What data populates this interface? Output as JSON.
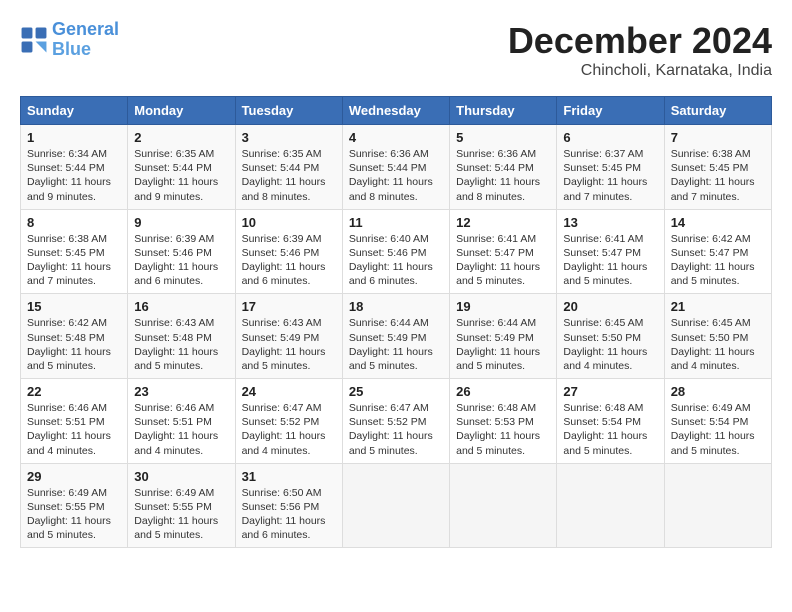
{
  "header": {
    "logo_line1": "General",
    "logo_line2": "Blue",
    "month": "December 2024",
    "location": "Chincholi, Karnataka, India"
  },
  "weekdays": [
    "Sunday",
    "Monday",
    "Tuesday",
    "Wednesday",
    "Thursday",
    "Friday",
    "Saturday"
  ],
  "weeks": [
    [
      {
        "day": "1",
        "info": "Sunrise: 6:34 AM\nSunset: 5:44 PM\nDaylight: 11 hours\nand 9 minutes."
      },
      {
        "day": "2",
        "info": "Sunrise: 6:35 AM\nSunset: 5:44 PM\nDaylight: 11 hours\nand 9 minutes."
      },
      {
        "day": "3",
        "info": "Sunrise: 6:35 AM\nSunset: 5:44 PM\nDaylight: 11 hours\nand 8 minutes."
      },
      {
        "day": "4",
        "info": "Sunrise: 6:36 AM\nSunset: 5:44 PM\nDaylight: 11 hours\nand 8 minutes."
      },
      {
        "day": "5",
        "info": "Sunrise: 6:36 AM\nSunset: 5:44 PM\nDaylight: 11 hours\nand 8 minutes."
      },
      {
        "day": "6",
        "info": "Sunrise: 6:37 AM\nSunset: 5:45 PM\nDaylight: 11 hours\nand 7 minutes."
      },
      {
        "day": "7",
        "info": "Sunrise: 6:38 AM\nSunset: 5:45 PM\nDaylight: 11 hours\nand 7 minutes."
      }
    ],
    [
      {
        "day": "8",
        "info": "Sunrise: 6:38 AM\nSunset: 5:45 PM\nDaylight: 11 hours\nand 7 minutes."
      },
      {
        "day": "9",
        "info": "Sunrise: 6:39 AM\nSunset: 5:46 PM\nDaylight: 11 hours\nand 6 minutes."
      },
      {
        "day": "10",
        "info": "Sunrise: 6:39 AM\nSunset: 5:46 PM\nDaylight: 11 hours\nand 6 minutes."
      },
      {
        "day": "11",
        "info": "Sunrise: 6:40 AM\nSunset: 5:46 PM\nDaylight: 11 hours\nand 6 minutes."
      },
      {
        "day": "12",
        "info": "Sunrise: 6:41 AM\nSunset: 5:47 PM\nDaylight: 11 hours\nand 5 minutes."
      },
      {
        "day": "13",
        "info": "Sunrise: 6:41 AM\nSunset: 5:47 PM\nDaylight: 11 hours\nand 5 minutes."
      },
      {
        "day": "14",
        "info": "Sunrise: 6:42 AM\nSunset: 5:47 PM\nDaylight: 11 hours\nand 5 minutes."
      }
    ],
    [
      {
        "day": "15",
        "info": "Sunrise: 6:42 AM\nSunset: 5:48 PM\nDaylight: 11 hours\nand 5 minutes."
      },
      {
        "day": "16",
        "info": "Sunrise: 6:43 AM\nSunset: 5:48 PM\nDaylight: 11 hours\nand 5 minutes."
      },
      {
        "day": "17",
        "info": "Sunrise: 6:43 AM\nSunset: 5:49 PM\nDaylight: 11 hours\nand 5 minutes."
      },
      {
        "day": "18",
        "info": "Sunrise: 6:44 AM\nSunset: 5:49 PM\nDaylight: 11 hours\nand 5 minutes."
      },
      {
        "day": "19",
        "info": "Sunrise: 6:44 AM\nSunset: 5:49 PM\nDaylight: 11 hours\nand 5 minutes."
      },
      {
        "day": "20",
        "info": "Sunrise: 6:45 AM\nSunset: 5:50 PM\nDaylight: 11 hours\nand 4 minutes."
      },
      {
        "day": "21",
        "info": "Sunrise: 6:45 AM\nSunset: 5:50 PM\nDaylight: 11 hours\nand 4 minutes."
      }
    ],
    [
      {
        "day": "22",
        "info": "Sunrise: 6:46 AM\nSunset: 5:51 PM\nDaylight: 11 hours\nand 4 minutes."
      },
      {
        "day": "23",
        "info": "Sunrise: 6:46 AM\nSunset: 5:51 PM\nDaylight: 11 hours\nand 4 minutes."
      },
      {
        "day": "24",
        "info": "Sunrise: 6:47 AM\nSunset: 5:52 PM\nDaylight: 11 hours\nand 4 minutes."
      },
      {
        "day": "25",
        "info": "Sunrise: 6:47 AM\nSunset: 5:52 PM\nDaylight: 11 hours\nand 5 minutes."
      },
      {
        "day": "26",
        "info": "Sunrise: 6:48 AM\nSunset: 5:53 PM\nDaylight: 11 hours\nand 5 minutes."
      },
      {
        "day": "27",
        "info": "Sunrise: 6:48 AM\nSunset: 5:54 PM\nDaylight: 11 hours\nand 5 minutes."
      },
      {
        "day": "28",
        "info": "Sunrise: 6:49 AM\nSunset: 5:54 PM\nDaylight: 11 hours\nand 5 minutes."
      }
    ],
    [
      {
        "day": "29",
        "info": "Sunrise: 6:49 AM\nSunset: 5:55 PM\nDaylight: 11 hours\nand 5 minutes."
      },
      {
        "day": "30",
        "info": "Sunrise: 6:49 AM\nSunset: 5:55 PM\nDaylight: 11 hours\nand 5 minutes."
      },
      {
        "day": "31",
        "info": "Sunrise: 6:50 AM\nSunset: 5:56 PM\nDaylight: 11 hours\nand 6 minutes."
      },
      {
        "day": "",
        "info": ""
      },
      {
        "day": "",
        "info": ""
      },
      {
        "day": "",
        "info": ""
      },
      {
        "day": "",
        "info": ""
      }
    ]
  ]
}
